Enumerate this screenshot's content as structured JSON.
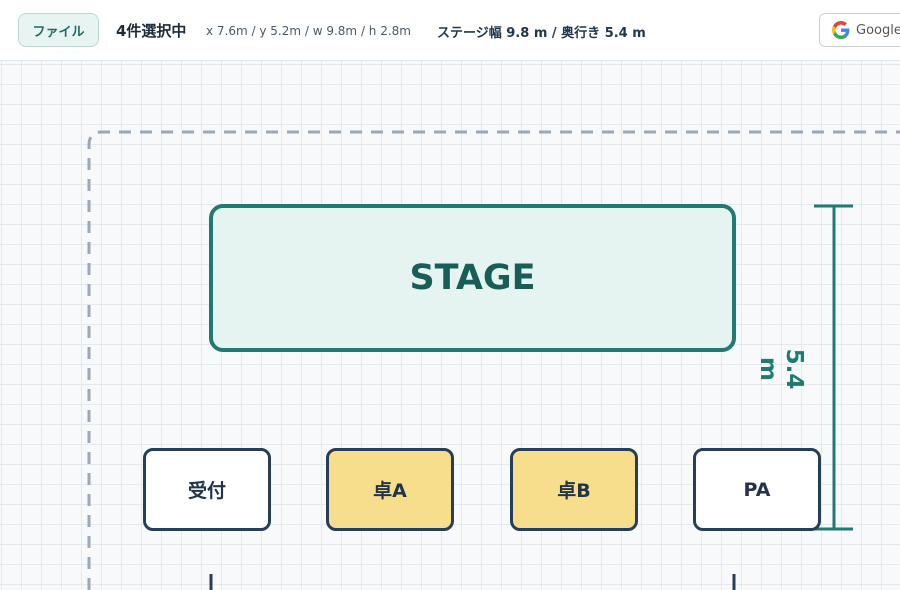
{
  "toolbar": {
    "file_label": "ファイル",
    "selection_count": "4件選択中",
    "selection_coords": "x 7.6m / y 5.2m / w 9.8m / h 2.8m",
    "stage_dims": "ステージ幅 9.8 m / 奥行き 5.4 m",
    "google_label": "Google"
  },
  "canvas": {
    "stage_label": "STAGE",
    "blocks": [
      {
        "label": "受付",
        "style": "white"
      },
      {
        "label": "卓A",
        "style": "yellow"
      },
      {
        "label": "卓B",
        "style": "yellow"
      },
      {
        "label": "PA",
        "style": "white"
      }
    ],
    "dimension_label": "5.4 m"
  },
  "colors": {
    "accent": "#1f7a72",
    "stage_fill": "#e6f4f1",
    "block_border": "#263e58",
    "table_fill": "#f7de8c",
    "venue_boundary": "#9aa8b8"
  }
}
